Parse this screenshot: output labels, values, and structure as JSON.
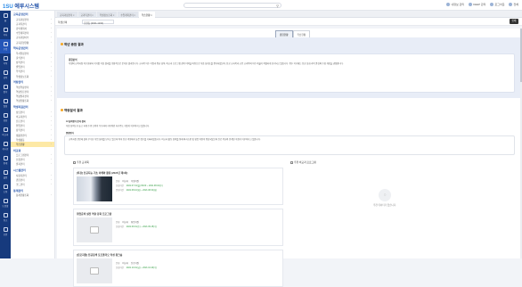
{
  "brand": {
    "name": "1SU",
    "sub": "에루시스템"
  },
  "search": {
    "placeholder": "메뉴명, 프로그램명을 검색해 주세요"
  },
  "topnav": [
    "내정보 관리",
    "KEEP 관리",
    "로그아웃",
    "전체"
  ],
  "icons": [
    {
      "name": "home-icon",
      "label": "홈"
    },
    {
      "name": "school-icon",
      "label": "학사"
    },
    {
      "name": "book-icon",
      "label": "수업"
    },
    {
      "name": "class-icon",
      "label": "학적"
    },
    {
      "name": "grade-icon",
      "label": "성적"
    },
    {
      "name": "scholarship-icon",
      "label": "장학"
    },
    {
      "name": "calendar-icon",
      "label": "일정"
    },
    {
      "name": "person-icon",
      "label": "상담"
    },
    {
      "name": "doc-icon",
      "label": "비교과"
    },
    {
      "name": "board-icon",
      "label": "게시판"
    },
    {
      "name": "chart-icon",
      "label": "통계"
    },
    {
      "name": "settings-icon",
      "label": "설정"
    },
    {
      "name": "chat-icon",
      "label": "소통"
    },
    {
      "name": "help-icon",
      "label": "도움말"
    },
    {
      "name": "link-icon",
      "label": "링크"
    },
    {
      "name": "lock-icon",
      "label": "보안"
    }
  ],
  "menu": [
    {
      "head": "교육운영관리",
      "items": [
        "교육과정관리",
        "교과목관리",
        "강의계획서",
        "수업계획관리",
        "교육과정이수",
        "교육운영현황"
      ]
    },
    {
      "head": "학사운영관리",
      "items": [
        "학사일정관리",
        "출석관리",
        "성적관리",
        "졸업관리",
        "학적관리",
        "학생정보조회"
      ]
    },
    {
      "head": "역량관리",
      "items": [
        "핵심역량관리",
        "역량진단관리",
        "역량결과관리",
        "역량현황조회"
      ]
    },
    {
      "head": "학생지원관리",
      "items": [
        "상담관리",
        "비교과관리",
        "진로관리",
        "취업관리",
        "장학관리",
        "생활관관리",
        "학생활동",
        "학습현황"
      ]
    },
    {
      "head": "비교과",
      "items": [
        "프로그램관리",
        "신청관리",
        "결과관리"
      ]
    },
    {
      "head": "시스템관리",
      "items": [
        "사용자관리",
        "권한관리",
        "코드관리"
      ]
    },
    {
      "head": "통계관리",
      "items": [
        "통계현황조회"
      ]
    }
  ],
  "tabs": [
    "교육과정관리",
    "교과목관리",
    "학생정보조회",
    "수업계획관리",
    "학습현황"
  ],
  "selector": {
    "label": "학생선택",
    "value": "홍길동 (2021-1234)"
  },
  "print_label": "인쇄",
  "pane_tabs": [
    "종합현황",
    "학습현황"
  ],
  "sec1": {
    "title": "학년 종합 결과",
    "label": "종합분석",
    "text": "학생의 교육과정 이수현황과 학기별 학습 결과를 종합적으로 분석한 결과입니다. 교과목 이수 학점과 평균 성적, 비교과 프로그램 참여 이력을 바탕으로 학습 성취도를 평가하였으며, 전공 교과목과 교양 교과목의 이수 비율이 적절하게 유지되고 있습니다. 향후 학기에는 전공 심화 과목 중심의 수강 계획을 권장합니다."
  },
  "sec2": {
    "title": "역량분석 결과",
    "line1_k": "AI 실력평가 분석 결과",
    "line1_v": "학습 참여도가 높고 과제 수행 능력이 우수하며 지속적인 자기주도 학습이 이루어지고 있습니다.",
    "box_label": "종합평가",
    "box_text": "교육과정 전반에 걸쳐 우수한 학업 성취를 보이고 있으며 특히 전공 역량에서 높은 점수를 기록하였습니다. 비교과 활동 참여를 통해 의사소통 및 협업 역량이 향상되었으며 진로 목표와 연계된 학습이 이루어지고 있습니다."
  },
  "col_left": "추천 교과목",
  "col_right": "추천 비교과 프로그램",
  "videos": [
    {
      "title": "[특강] 인공지능 기초 이해와 활용 (2021년 제1차)",
      "photo": true,
      "meta": [
        [
          "분류",
          "비교과",
          "학생지원"
        ],
        [
          "신청기간",
          "2021.07.19(월) 09:00 ~ 2021.08.04(수)"
        ],
        [
          "운영기간",
          "2021.08.10(화) ~ 2021.08.31(화)"
        ]
      ]
    },
    {
      "title": "취업준비 실전 역량 강화 프로그램",
      "photo": false,
      "meta": [
        [
          "분류",
          "비교과",
          "취업지원"
        ],
        [
          "신청기간",
          "2021.09.01(수) ~ 2021.09.15(수)"
        ]
      ]
    },
    {
      "title": "[진로지원] 전공탐색 포트폴리오 작성 워크숍",
      "photo": false,
      "meta": [
        [
          "분류",
          "비교과",
          "진로지원"
        ],
        [
          "신청기간",
          "2021.10.01(금) ~ 2021.10.20(수)"
        ]
      ]
    }
  ],
  "empty_msg": "추천 데이터가 없습니다."
}
